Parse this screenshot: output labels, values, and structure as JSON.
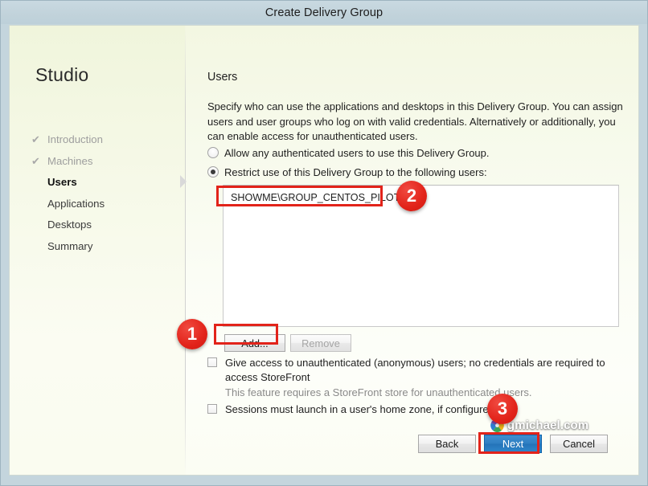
{
  "window": {
    "title": "Create Delivery Group"
  },
  "sidebar": {
    "product": "Studio",
    "steps": [
      {
        "label": "Introduction",
        "state": "done",
        "check": "✔"
      },
      {
        "label": "Machines",
        "state": "done",
        "check": "✔"
      },
      {
        "label": "Users",
        "state": "current",
        "check": ""
      },
      {
        "label": "Applications",
        "state": "pending",
        "check": ""
      },
      {
        "label": "Desktops",
        "state": "pending",
        "check": ""
      },
      {
        "label": "Summary",
        "state": "pending",
        "check": ""
      }
    ]
  },
  "main": {
    "heading": "Users",
    "description": "Specify who can use the applications and desktops in this Delivery Group. You can assign users and user groups who log on with valid credentials. Alternatively or additionally, you can enable access for unauthenticated users.",
    "radios": [
      {
        "label": "Allow any authenticated users to use this Delivery Group.",
        "selected": false
      },
      {
        "label": "Restrict use of this Delivery Group to the following users:",
        "selected": true
      }
    ],
    "user_list": [
      "SHOWME\\GROUP_CENTOS_PILOT"
    ],
    "buttons": {
      "add": "Add...",
      "remove": "Remove"
    },
    "checkboxes": [
      {
        "label": "Give access to unauthenticated (anonymous) users; no credentials are required to access StoreFront",
        "sublabel": "This feature requires a StoreFront store for unauthenticated users.",
        "checked": false
      },
      {
        "label": "Sessions must launch in a user's home zone, if configured.",
        "sublabel": "",
        "checked": false
      }
    ]
  },
  "footer": {
    "back": "Back",
    "next": "Next",
    "cancel": "Cancel"
  },
  "annotations": {
    "badges": [
      {
        "number": "1",
        "target": "add-button"
      },
      {
        "number": "2",
        "target": "user-list-item"
      },
      {
        "number": "3",
        "target": "next-button"
      }
    ],
    "color": "#e2231a"
  },
  "watermark": {
    "text": "gmichael.com"
  }
}
